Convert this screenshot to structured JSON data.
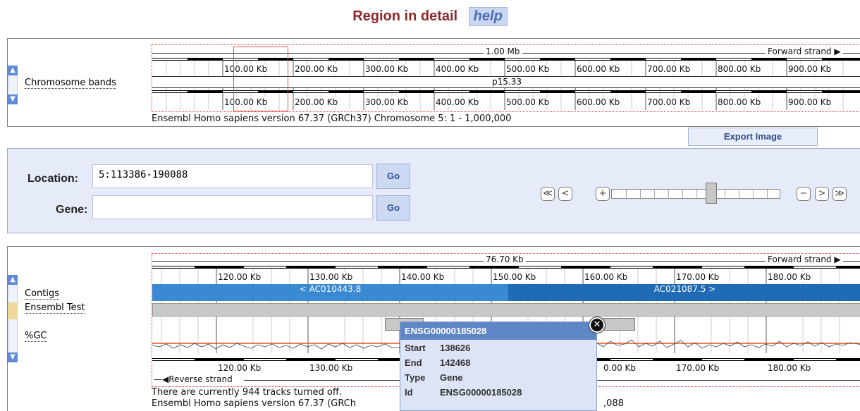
{
  "header": {
    "title": "Region in detail",
    "help_label": "help"
  },
  "chromosome_panel": {
    "track_label": "Chromosome bands",
    "scale_top": "1.00 Mb",
    "forward_strand": "Forward strand",
    "ticks": [
      "100.00 Kb",
      "200.00 Kb",
      "300.00 Kb",
      "400.00 Kb",
      "500.00 Kb",
      "600.00 Kb",
      "700.00 Kb",
      "800.00 Kb",
      "900.00 Kb"
    ],
    "band_label": "p15.33",
    "caption": "Ensembl Homo sapiens version 67.37 (GRCh37) Chromosome 5: 1 - 1,000,000"
  },
  "export_button": "Export Image",
  "navigation": {
    "location_label": "Location:",
    "location_value": "5:113386-190088",
    "gene_label": "Gene:",
    "gene_value": "",
    "go_label": "Go"
  },
  "detail_panel": {
    "scale_top": "76.70 Kb",
    "forward_strand": "Forward strand",
    "reverse_strand": "Reverse strand",
    "ticks_top": [
      "120.00 Kb",
      "130.00 Kb",
      "140.00 Kb",
      "150.00 Kb",
      "160.00 Kb",
      "170.00 Kb",
      "180.00 Kb"
    ],
    "ticks_bottom": [
      "120.00 Kb",
      "130.00 Kb",
      "0.00 Kb",
      "170.00 Kb",
      "180.00 Kb"
    ],
    "tracks": [
      "Contigs",
      "Ensembl Test",
      "%GC"
    ],
    "contig_left": "< AC010443.8",
    "contig_right": "AC021087.5 >",
    "footer_line1": "There are currently 944 tracks turned off.",
    "footer_line2_left": "Ensembl Homo sapiens version 67.37 (GRCh",
    "footer_line2_right": ",088"
  },
  "popup": {
    "title": "ENSG00000185028",
    "rows": [
      {
        "key": "Start",
        "value": "138626"
      },
      {
        "key": "End",
        "value": "142468"
      },
      {
        "key": "Type",
        "value": "Gene"
      },
      {
        "key": "Id",
        "value": "ENSG00000185028"
      }
    ]
  },
  "colors": {
    "title": "#8b2a2a",
    "contig_left": "#3a8ad3",
    "contig_right": "#1f6bb5",
    "gc_line": "#e05020",
    "popup_header": "#5f86c6"
  }
}
